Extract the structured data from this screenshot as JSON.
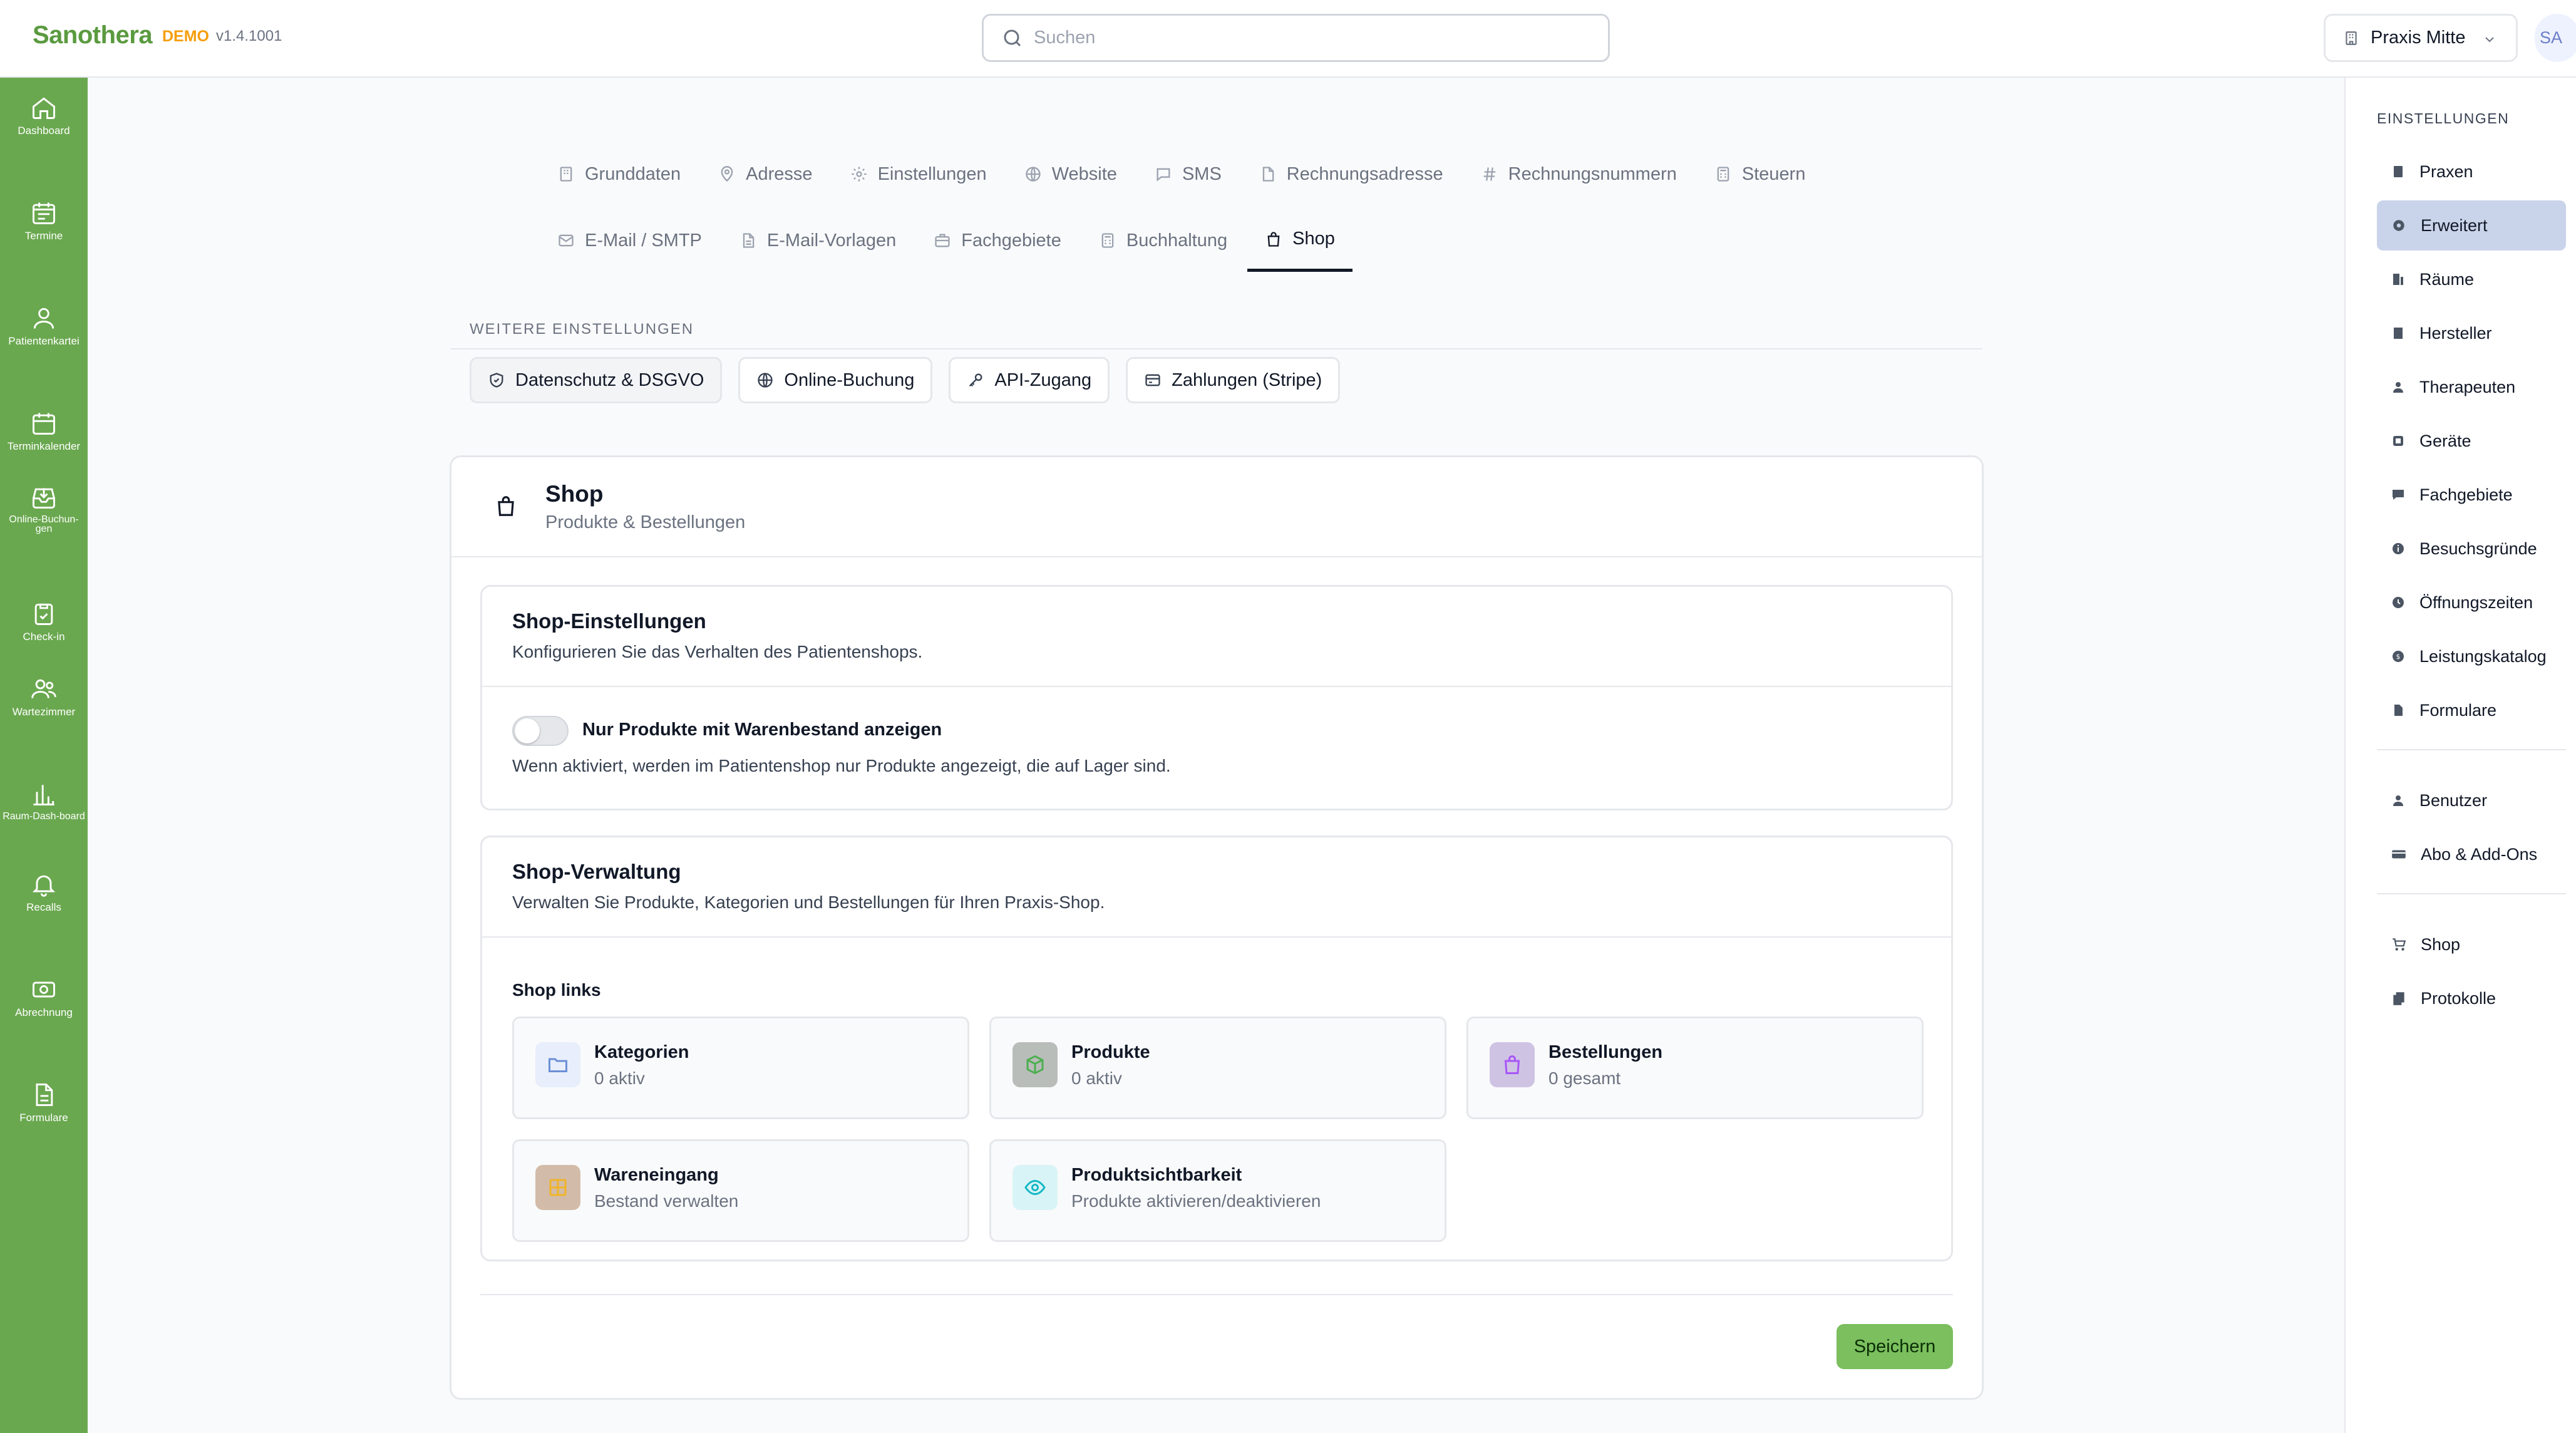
{
  "app": {
    "brand": "Sanothera",
    "badge": "DEMO",
    "version": "v1.4.1001"
  },
  "search": {
    "placeholder": "Suchen"
  },
  "practice_selector": {
    "label": "Praxis Mitte"
  },
  "avatar": {
    "initials": "SA"
  },
  "left_nav": [
    {
      "label": "Dashboard",
      "icon": "home-icon"
    },
    {
      "label": "Termine",
      "icon": "calendar-list-icon"
    },
    {
      "label": "Patientenkartei",
      "icon": "user-icon"
    },
    {
      "label": "Terminkalender",
      "icon": "calendar-icon"
    },
    {
      "label": "Online-Buchun-gen",
      "icon": "inbox-download-icon"
    },
    {
      "label": "Check-in",
      "icon": "clipboard-check-icon"
    },
    {
      "label": "Wartezimmer",
      "icon": "users-icon"
    },
    {
      "label": "Raum-Dash-board",
      "icon": "bar-chart-icon"
    },
    {
      "label": "Recalls",
      "icon": "bell-icon"
    },
    {
      "label": "Abrechnung",
      "icon": "money-icon"
    },
    {
      "label": "Formulare",
      "icon": "file-icon"
    }
  ],
  "tabs": {
    "row1": [
      "Grunddaten",
      "Adresse",
      "Einstellungen",
      "Website",
      "SMS",
      "Rechnungsadresse",
      "Rechnungsnummern",
      "Steuern"
    ],
    "row2": [
      "E-Mail / SMTP",
      "E-Mail-Vorlagen",
      "Fachgebiete",
      "Buchhaltung",
      "Shop"
    ],
    "active": "Shop"
  },
  "more_settings": {
    "label": "WEITERE EINSTELLUNGEN",
    "items": [
      "Datenschutz & DSGVO",
      "Online-Buchung",
      "API-Zugang",
      "Zahlungen (Stripe)"
    ]
  },
  "card": {
    "title": "Shop",
    "subtitle": "Produkte & Bestellungen"
  },
  "shop_settings": {
    "title": "Shop-Einstellungen",
    "description": "Konfigurieren Sie das Verhalten des Patientenshops.",
    "toggle_label": "Nur Produkte mit Warenbestand anzeigen",
    "toggle_on": false,
    "toggle_description": "Wenn aktiviert, werden im Patientenshop nur Produkte angezeigt, die auf Lager sind."
  },
  "shop_admin": {
    "title": "Shop-Verwaltung",
    "description": "Verwalten Sie Produkte, Kategorien und Bestellungen für Ihren Praxis-Shop.",
    "links_label": "Shop links",
    "tiles": [
      {
        "title": "Kategorien",
        "subtitle": "0 aktiv",
        "icon": "folder-icon",
        "color": "#6b8fd6",
        "bg": "#e8eefb"
      },
      {
        "title": "Produkte",
        "subtitle": "0 aktiv",
        "icon": "cube-icon",
        "color": "#4caf50",
        "bg": "#b9bdb9"
      },
      {
        "title": "Bestellungen",
        "subtitle": "0 gesamt",
        "icon": "shopping-bag-icon",
        "color": "#a855f7",
        "bg": "#cfc3e4"
      },
      {
        "title": "Wareneingang",
        "subtitle": "Bestand verwalten",
        "icon": "package-icon",
        "color": "#f0b429",
        "bg": "#d2bca9"
      },
      {
        "title": "Produktsichtbarkeit",
        "subtitle": "Produkte aktivieren/deaktivieren",
        "icon": "eye-icon",
        "color": "#14b8c6",
        "bg": "#d9f4f6"
      }
    ]
  },
  "actions": {
    "save_label": "Speichern"
  },
  "right_panel": {
    "title": "EINSTELLUNGEN",
    "group1": [
      "Praxen",
      "Erweitert",
      "Räume",
      "Hersteller",
      "Therapeuten",
      "Geräte",
      "Fachgebiete",
      "Besuchsgründe",
      "Öffnungszeiten",
      "Leistungskatalog",
      "Formulare"
    ],
    "group2": [
      "Benutzer",
      "Abo & Add-Ons"
    ],
    "group3": [
      "Shop",
      "Protokolle"
    ],
    "active": "Erweitert"
  }
}
